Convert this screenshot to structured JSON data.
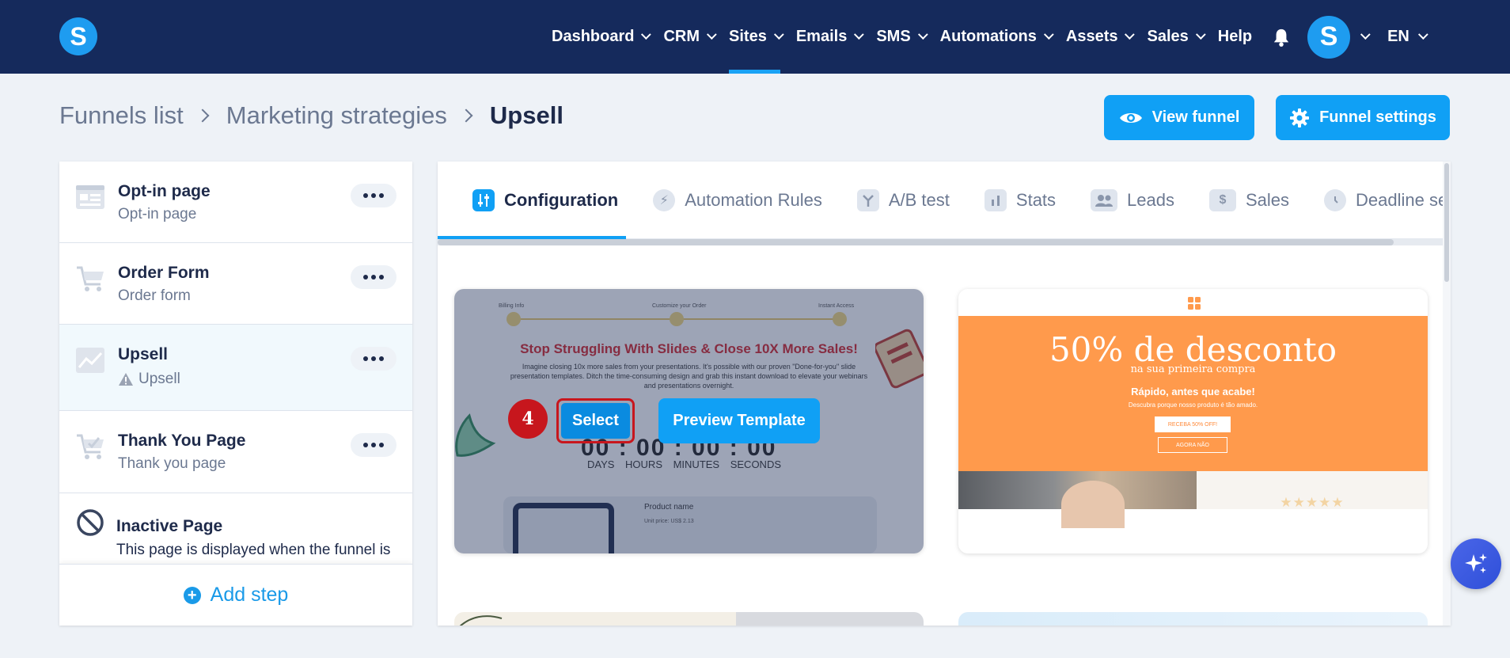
{
  "app": {
    "logo_letter": "S",
    "nav": [
      {
        "label": "Dashboard",
        "active": false
      },
      {
        "label": "CRM",
        "active": false
      },
      {
        "label": "Sites",
        "active": true
      },
      {
        "label": "Emails",
        "active": false
      },
      {
        "label": "SMS",
        "active": false
      },
      {
        "label": "Automations",
        "active": false
      },
      {
        "label": "Assets",
        "active": false
      },
      {
        "label": "Sales",
        "active": false
      }
    ],
    "help_label": "Help",
    "avatar_letter": "S",
    "language": "EN"
  },
  "breadcrumb": {
    "items": [
      "Funnels list",
      "Marketing strategies",
      "Upsell"
    ]
  },
  "header_buttons": {
    "view_funnel": "View funnel",
    "funnel_settings": "Funnel settings"
  },
  "sidebar": {
    "steps": [
      {
        "title": "Opt-in page",
        "subtitle": "Opt-in page",
        "icon": "optin-page-icon"
      },
      {
        "title": "Order Form",
        "subtitle": "Order form",
        "icon": "cart-icon"
      },
      {
        "title": "Upsell",
        "subtitle": "Upsell",
        "icon": "chart-image-icon",
        "warning": true
      },
      {
        "title": "Thank You Page",
        "subtitle": "Thank you page",
        "icon": "cart-check-icon"
      }
    ],
    "inactive": {
      "title": "Inactive Page",
      "description": "This page is displayed when the funnel is disabled"
    },
    "add_step_label": "Add step"
  },
  "tabs": [
    {
      "label": "Configuration",
      "icon": "sliders-icon",
      "active": true
    },
    {
      "label": "Automation Rules",
      "icon": "bolt-icon",
      "active": false
    },
    {
      "label": "A/B test",
      "icon": "split-icon",
      "active": false
    },
    {
      "label": "Stats",
      "icon": "bar-chart-icon",
      "active": false
    },
    {
      "label": "Leads",
      "icon": "users-icon",
      "active": false
    },
    {
      "label": "Sales",
      "icon": "dollar-icon",
      "active": false
    },
    {
      "label": "Deadline settings",
      "icon": "clock-icon",
      "active": false
    }
  ],
  "templates": {
    "t1": {
      "steps": [
        "Billing Info",
        "Customize your Order",
        "Instant Access"
      ],
      "headline": "Stop Struggling With Slides & Close 10X More Sales!",
      "body": "Imagine closing 10x more sales from your presentations. It's possible with our proven \"Done-for-you\" slide presentation templates. Ditch the time-consuming design and grab this instant download to elevate your webinars and presentations overnight.",
      "timer": "00 : 00 : 00 : 00",
      "timer_labels": "DAYS HOURS MINUTES SECONDS",
      "product_name": "Product name",
      "unit_price": "Unit price: US$ 2.13",
      "step_number": "4",
      "select_label": "Select",
      "preview_label": "Preview Template"
    },
    "t2": {
      "big_text": "50% de desconto",
      "sub_text": "na sua primeira compra",
      "bold_text": "Rápido, antes que acabe!",
      "small_text": "Descubra porque nosso produto é tão amado.",
      "btn1": "RECEBA 50% OFF!",
      "btn2": "AGORA NÃO",
      "stars": "★★★★★"
    }
  },
  "colors": {
    "topbar": "#152a5c",
    "primary": "#10a0f5",
    "highlight_red": "#c7161d",
    "orange": "#ff9a4c"
  }
}
